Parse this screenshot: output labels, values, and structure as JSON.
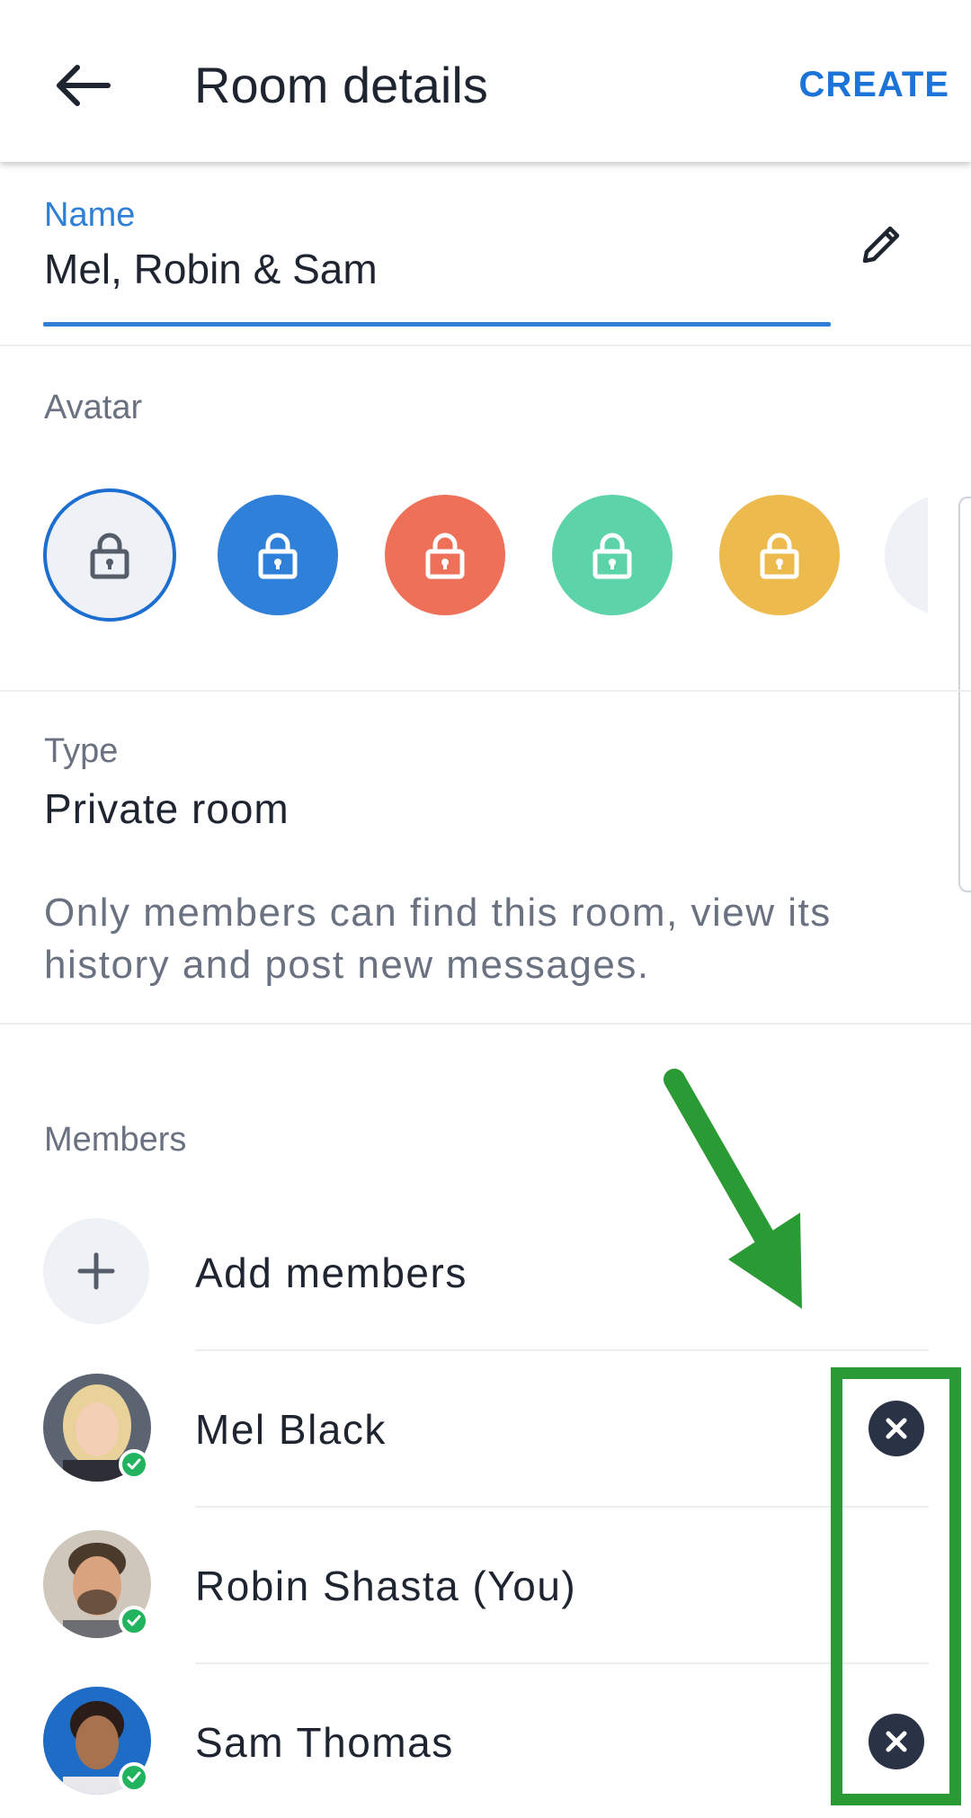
{
  "appbar": {
    "title": "Room details",
    "create_label": "CREATE"
  },
  "name_field": {
    "label": "Name",
    "value": "Mel, Robin & Sam"
  },
  "avatar_section": {
    "label": "Avatar",
    "options": [
      {
        "color": "#eef1f6",
        "icon": "lock-icon",
        "selected": true
      },
      {
        "color": "#2f80d8",
        "icon": "lock-icon"
      },
      {
        "color": "#ee7059",
        "icon": "lock-icon"
      },
      {
        "color": "#5cd3a8",
        "icon": "lock-icon"
      },
      {
        "color": "#ecba4d",
        "icon": "lock-icon"
      },
      {
        "color": "#eef1f6",
        "icon": "lock-icon"
      }
    ]
  },
  "type_section": {
    "label": "Type",
    "value": "Private room",
    "description": "Only members can find this room, view its history and post new messages."
  },
  "members_section": {
    "label": "Members",
    "add_label": "Add members",
    "members": [
      {
        "name": "Mel Black",
        "status": "online",
        "removable": true
      },
      {
        "name": "Robin Shasta (You)",
        "status": "online",
        "removable": false
      },
      {
        "name": "Sam Thomas",
        "status": "online",
        "removable": true
      }
    ]
  },
  "colors": {
    "accent": "#1c74d9",
    "annotation": "#2a9a35",
    "presence": "#22b35e"
  }
}
